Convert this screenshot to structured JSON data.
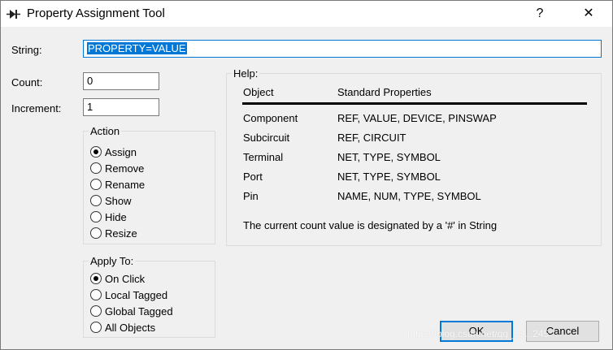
{
  "window": {
    "title": "Property Assignment Tool",
    "help_button": "?",
    "close_button": "✕"
  },
  "fields": {
    "string_label": "String:",
    "string_value": "PROPERTY=VALUE",
    "count_label": "Count:",
    "count_value": "0",
    "increment_label": "Increment:",
    "increment_value": "1"
  },
  "action": {
    "legend": "Action",
    "options": [
      "Assign",
      "Remove",
      "Rename",
      "Show",
      "Hide",
      "Resize"
    ],
    "selected": "Assign"
  },
  "apply_to": {
    "legend": "Apply To:",
    "options": [
      "On Click",
      "Local Tagged",
      "Global Tagged",
      "All Objects"
    ],
    "selected": "On Click"
  },
  "help": {
    "legend": "Help:",
    "headers": [
      "Object",
      "Standard Properties"
    ],
    "rows": [
      [
        "Component",
        "REF, VALUE, DEVICE, PINSWAP"
      ],
      [
        "Subcircuit",
        "REF, CIRCUIT"
      ],
      [
        "Terminal",
        "NET, TYPE, SYMBOL"
      ],
      [
        "Port",
        "NET, TYPE, SYMBOL"
      ],
      [
        "Pin",
        "NAME, NUM, TYPE, SYMBOL"
      ]
    ],
    "note": "The current count value is designated by a '#' in String"
  },
  "buttons": {
    "ok": "OK",
    "cancel": "Cancel"
  },
  "watermark": "https://blog.csdn.net/qq_33...245"
}
